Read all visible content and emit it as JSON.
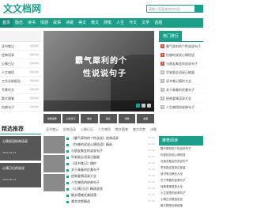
{
  "header": {
    "logo": "文文档网",
    "logo_sub": "WENWENDANG",
    "search_placeholder": "请输入您要查找的内容"
  },
  "nav": {
    "items": [
      "首页",
      "励志",
      "读书",
      "情感",
      "故事",
      "诗歌",
      "美文",
      "散文",
      "随笔",
      "人生",
      "作文",
      "文学",
      "话题"
    ]
  },
  "left_col": {
    "rows": [
      {
        "label": "读书笔记",
        "date": "05-15"
      },
      {
        "label": "经典语录",
        "date": "05-15"
      },
      {
        "label": "心情日记",
        "date": "05-15"
      },
      {
        "label": "人生感悟",
        "date": "05-14"
      },
      {
        "label": "工作总结报告",
        "date": "05-14"
      },
      {
        "label": "写景作文",
        "date": "05-14"
      },
      {
        "label": "散文随笔",
        "date": "05-14"
      },
      {
        "label": "伤感句子",
        "date": "05-13"
      }
    ]
  },
  "banner": {
    "line1": "霸气犀利的个",
    "line2": "性说说句子"
  },
  "thumbs": [
    "经典语录",
    "心情日记",
    "散文",
    "美文",
    "诗歌",
    "故事"
  ],
  "right_col": {
    "title": "热门排行",
    "rows": [
      {
        "num": "1",
        "text": "霸气犀利的个性说说句子"
      },
      {
        "num": "2",
        "text": "伤感的说说心情短语"
      },
      {
        "num": "3",
        "text": "与朋友聚会的说说句子"
      },
      {
        "num": "4",
        "text": "早安励志语录正能量"
      },
      {
        "num": "5",
        "text": "读书笔记摘抄大全"
      },
      {
        "num": "6",
        "text": "关于青春的优美句子"
      },
      {
        "num": "7",
        "text": "经典爱情语录大全"
      },
      {
        "num": "8",
        "text": "人生感悟的经典句子"
      }
    ]
  },
  "section": {
    "title": "精选推荐",
    "cats": [
      "读书笔记",
      "经典语录",
      "心情日记",
      "人生感悟",
      "散文随笔",
      "美文欣赏",
      "诗歌"
    ]
  },
  "left_cards": [
    {
      "title": "心情短语经典语录",
      "sub": "2024-05-15"
    },
    {
      "title": "心情日记的说说",
      "sub": "2024-05-15"
    }
  ],
  "list": [
    {
      "text": "《霸气犀利的个性说说》经典语录",
      "date": "05-15"
    },
    {
      "text": "《伤感的说说心情短语》精选",
      "date": "05-15"
    },
    {
      "text": "与朋友聚会的说说句子",
      "date": "05-15"
    },
    {
      "text": "早安励志语录正能量",
      "date": "05-14"
    },
    {
      "text": "《读书笔记》摘抄",
      "date": "05-14"
    },
    {
      "text": "关于青春的优美句子",
      "date": "05-14"
    },
    {
      "text": "经典爱情语录大全",
      "date": "05-14"
    },
    {
      "text": "人生感悟的经典句子",
      "date": "05-14"
    },
    {
      "text": "《心情日记》精选说说",
      "date": "05-13"
    },
    {
      "text": "散文随笔优美段落",
      "date": "05-13"
    },
    {
      "text": "美文欣赏精选",
      "date": "05-13"
    }
  ],
  "right2": {
    "title": "推荐阅读",
    "rows": [
      "霸气犀利的个性说说句子",
      "伤感的说说心情短语",
      "与朋友聚会的说说句子",
      "早安励志语录正能量",
      "读书笔记摘抄大全",
      "关于青春的优美句子",
      "经典爱情语录大全",
      "人生感悟的经典句子",
      "心情日记精选说说",
      "散文随笔优美段落"
    ]
  },
  "colors": {
    "accent": "#1a9f88",
    "hot": "#e74c3c"
  }
}
